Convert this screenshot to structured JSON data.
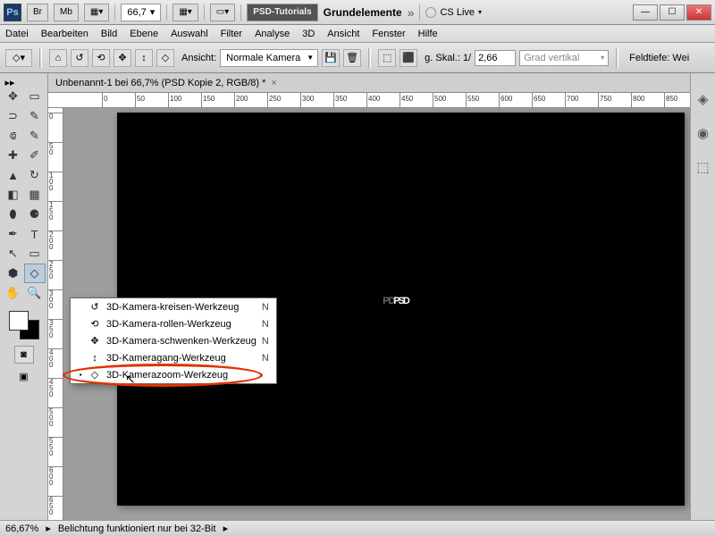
{
  "titlebar": {
    "br": "Br",
    "mb": "Mb",
    "zoom": "66,7",
    "psd_tutorials": "PSD-Tutorials",
    "grundelemente": "Grundelemente",
    "cs_live": "CS Live"
  },
  "menubar": [
    "Datei",
    "Bearbeiten",
    "Bild",
    "Ebene",
    "Auswahl",
    "Filter",
    "Analyse",
    "3D",
    "Ansicht",
    "Fenster",
    "Hilfe"
  ],
  "optbar": {
    "view_label": "Ansicht:",
    "view_value": "Normale Kamera",
    "scale_label": "g. Skal.: 1/",
    "scale_value": "2,66",
    "grad_placeholder": "Grad vertikal",
    "feldtiefe": "Feldtiefe: Wei"
  },
  "doc_tab": "Unbenannt-1 bei 66,7% (PSD Kopie 2, RGB/8) *",
  "canvas_text_main": "PSD",
  "canvas_text_shadow": "P  D",
  "ruler_top": [
    "0",
    "50",
    "100",
    "150",
    "200",
    "250",
    "300",
    "350",
    "400",
    "450",
    "500",
    "550",
    "600",
    "650",
    "700",
    "750",
    "800",
    "850"
  ],
  "ruler_left": [
    "0",
    "5 0",
    "1 0 0",
    "1 5 0",
    "2 0 0",
    "2 5 0",
    "3 0 0",
    "3 5 0",
    "4 0 0",
    "4 5 0",
    "5 0 0",
    "5 5 0",
    "6 0 0",
    "6 5 0"
  ],
  "flyout": [
    {
      "dot": "",
      "icon": "↺",
      "label": "3D-Kamera-kreisen-Werkzeug",
      "sc": "N"
    },
    {
      "dot": "",
      "icon": "⟲",
      "label": "3D-Kamera-rollen-Werkzeug",
      "sc": "N"
    },
    {
      "dot": "",
      "icon": "✥",
      "label": "3D-Kamera-schwenken-Werkzeug",
      "sc": "N"
    },
    {
      "dot": "",
      "icon": "↕",
      "label": "3D-Kameragang-Werkzeug",
      "sc": "N"
    },
    {
      "dot": "▪",
      "icon": "◇",
      "label": "3D-Kamerazoom-Werkzeug",
      "sc": ""
    }
  ],
  "status": {
    "zoom": "66,67%",
    "msg": "Belichtung funktioniert nur bei 32-Bit"
  }
}
